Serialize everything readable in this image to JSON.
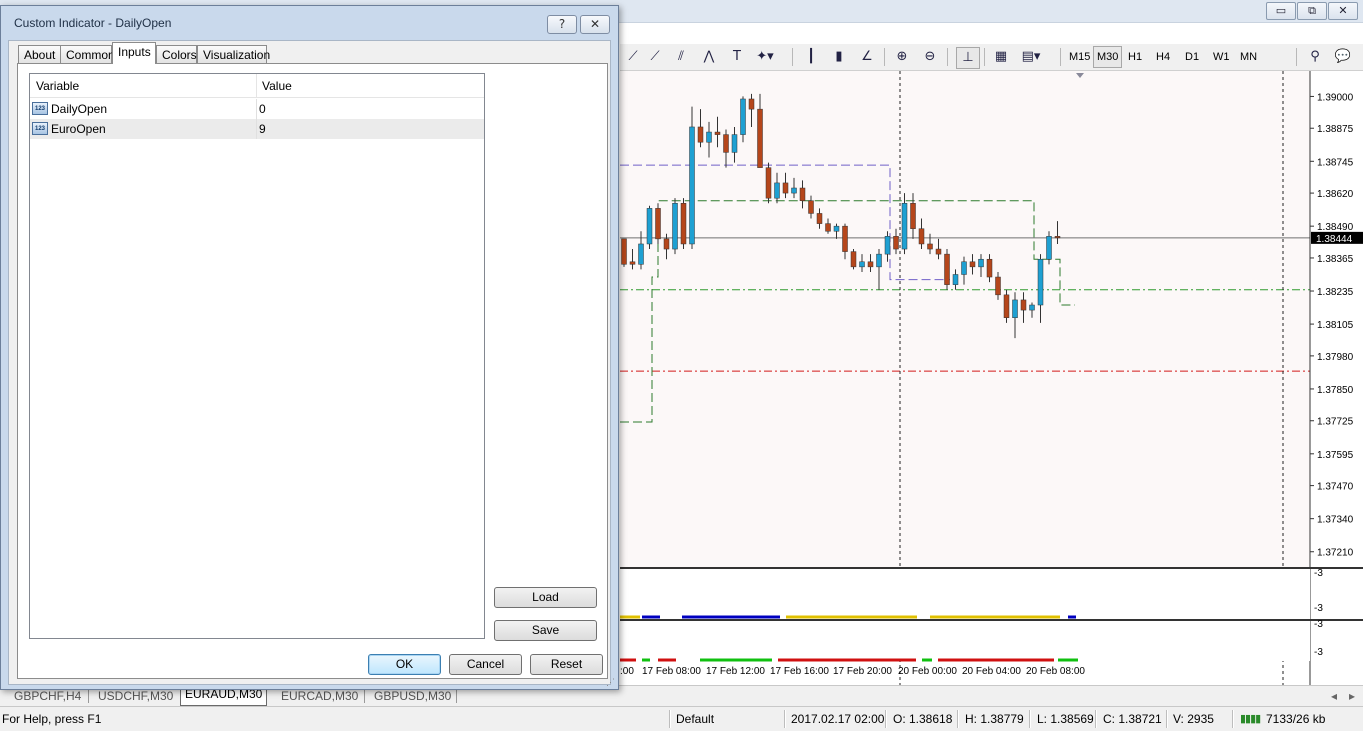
{
  "dialog": {
    "title": "Custom Indicator - DailyOpen",
    "help_button": "?",
    "close_button": "✕",
    "tabs": [
      "About",
      "Common",
      "Inputs",
      "Colors",
      "Visualization"
    ],
    "active_tab": "Inputs",
    "grid": {
      "columns": [
        "Variable",
        "Value"
      ],
      "rows": [
        {
          "variable": "DailyOpen",
          "value": "0",
          "icon": "123"
        },
        {
          "variable": "EuroOpen",
          "value": "9",
          "icon": "123"
        }
      ]
    },
    "load_button": "Load",
    "save_button": "Save",
    "ok_button": "OK",
    "cancel_button": "Cancel",
    "reset_button": "Reset"
  },
  "window_controls": {
    "minimize": "▭",
    "restore": "⧉",
    "close": "✕"
  },
  "toolbar": {
    "timeframes": [
      "M15",
      "M30",
      "H1",
      "H4",
      "D1",
      "W1",
      "MN"
    ],
    "active_timeframe": "M30"
  },
  "chart_data": {
    "type": "candlestick",
    "symbol": "EURAUD",
    "timeframe": "M30",
    "price_axis": [
      "1.39000",
      "1.38875",
      "1.38745",
      "1.38620",
      "1.38490",
      "1.38365",
      "1.38235",
      "1.38105",
      "1.37980",
      "1.37850",
      "1.37725",
      "1.37595",
      "1.37470",
      "1.37340",
      "1.37210"
    ],
    "current_price_label": "1.38444",
    "time_axis": [
      ":00",
      "17 Feb 08:00",
      "17 Feb 12:00",
      "17 Feb 16:00",
      "17 Feb 20:00",
      "20 Feb 00:00",
      "20 Feb 04:00",
      "20 Feb 08:00"
    ],
    "subwindow_labels": [
      "-3",
      "-3",
      "-3",
      "-3"
    ],
    "ylim": [
      1.3715,
      1.391
    ],
    "levels": [
      {
        "name": "red-dashdot",
        "price": 1.3792,
        "color": "#d11a1a"
      },
      {
        "name": "green-dashdot",
        "price": 1.3824,
        "color": "#2e9a2e"
      },
      {
        "name": "current",
        "price": 1.38444,
        "color": "#707070"
      }
    ],
    "candles": [
      [
        1.3844,
        1.3844,
        1.3833,
        1.3834
      ],
      [
        1.3835,
        1.384,
        1.3832,
        1.3834
      ],
      [
        1.3834,
        1.3847,
        1.3832,
        1.3842
      ],
      [
        1.3842,
        1.3857,
        1.384,
        1.3856
      ],
      [
        1.3856,
        1.3858,
        1.3842,
        1.3844
      ],
      [
        1.3844,
        1.3846,
        1.3836,
        1.384
      ],
      [
        1.384,
        1.386,
        1.3838,
        1.3858
      ],
      [
        1.3858,
        1.386,
        1.384,
        1.3842
      ],
      [
        1.3842,
        1.3896,
        1.384,
        1.3888
      ],
      [
        1.3888,
        1.3895,
        1.388,
        1.3882
      ],
      [
        1.3882,
        1.389,
        1.3876,
        1.3886
      ],
      [
        1.3886,
        1.3892,
        1.388,
        1.3885
      ],
      [
        1.3885,
        1.3887,
        1.3872,
        1.3878
      ],
      [
        1.3878,
        1.3888,
        1.3874,
        1.3885
      ],
      [
        1.3885,
        1.39,
        1.3882,
        1.3899
      ],
      [
        1.3899,
        1.3901,
        1.3888,
        1.3895
      ],
      [
        1.3895,
        1.3901,
        1.3872,
        1.3872
      ],
      [
        1.3872,
        1.3874,
        1.3858,
        1.386
      ],
      [
        1.386,
        1.387,
        1.3858,
        1.3866
      ],
      [
        1.3866,
        1.387,
        1.386,
        1.3862
      ],
      [
        1.3862,
        1.3868,
        1.386,
        1.3864
      ],
      [
        1.3864,
        1.3867,
        1.3856,
        1.3859
      ],
      [
        1.3859,
        1.3861,
        1.3852,
        1.3854
      ],
      [
        1.3854,
        1.3856,
        1.3848,
        1.385
      ],
      [
        1.385,
        1.3852,
        1.3846,
        1.3847
      ],
      [
        1.3847,
        1.385,
        1.3844,
        1.3849
      ],
      [
        1.3849,
        1.385,
        1.3836,
        1.3839
      ],
      [
        1.3839,
        1.384,
        1.3832,
        1.3833
      ],
      [
        1.3833,
        1.3838,
        1.3831,
        1.3835
      ],
      [
        1.3835,
        1.3838,
        1.3831,
        1.3833
      ],
      [
        1.3833,
        1.384,
        1.3824,
        1.3838
      ],
      [
        1.3838,
        1.3847,
        1.3835,
        1.3845
      ],
      [
        1.3845,
        1.3848,
        1.3838,
        1.384
      ],
      [
        1.384,
        1.3862,
        1.3838,
        1.3858
      ],
      [
        1.3858,
        1.3862,
        1.3844,
        1.3848
      ],
      [
        1.3848,
        1.3852,
        1.384,
        1.3842
      ],
      [
        1.3842,
        1.3846,
        1.3838,
        1.384
      ],
      [
        1.384,
        1.3844,
        1.3836,
        1.3838
      ],
      [
        1.3838,
        1.384,
        1.3824,
        1.3826
      ],
      [
        1.3826,
        1.3832,
        1.3824,
        1.383
      ],
      [
        1.383,
        1.3837,
        1.3826,
        1.3835
      ],
      [
        1.3835,
        1.3838,
        1.383,
        1.3833
      ],
      [
        1.3833,
        1.3838,
        1.3829,
        1.3836
      ],
      [
        1.3836,
        1.3838,
        1.3827,
        1.3829
      ],
      [
        1.3829,
        1.3831,
        1.382,
        1.3822
      ],
      [
        1.3822,
        1.3824,
        1.3811,
        1.3813
      ],
      [
        1.3813,
        1.3823,
        1.3805,
        1.382
      ],
      [
        1.382,
        1.3823,
        1.3811,
        1.3816
      ],
      [
        1.3816,
        1.3819,
        1.3813,
        1.3818
      ],
      [
        1.3818,
        1.3838,
        1.3811,
        1.3836
      ],
      [
        1.3836,
        1.3847,
        1.3834,
        1.3845
      ],
      [
        1.3845,
        1.3851,
        1.3842,
        1.38444
      ]
    ]
  },
  "chart_tabs": [
    "GBPCHF,H4",
    "USDCHF,M30",
    "EURAUD,M30",
    "EURCAD,M30",
    "GBPUSD,M30"
  ],
  "active_chart_tab": "EURAUD,M30",
  "status": {
    "help": "For Help, press F1",
    "profile": "Default",
    "datetime": "2017.02.17 02:00",
    "open": "O: 1.38618",
    "high": "H: 1.38779",
    "low": "L: 1.38569",
    "close": "C: 1.38721",
    "volume": "V: 2935",
    "traffic": "7133/26 kb"
  }
}
